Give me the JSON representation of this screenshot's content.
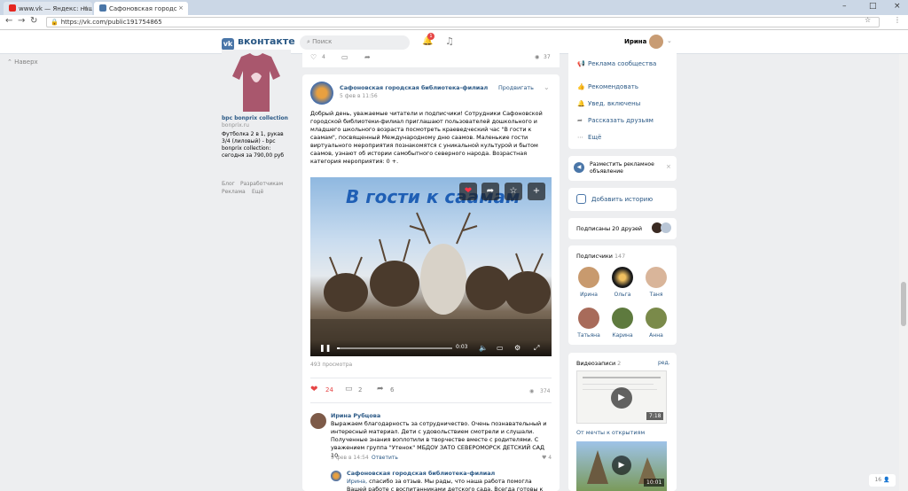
{
  "browser": {
    "tabs": [
      {
        "title": "www.vk — Яндекс: наш"
      },
      {
        "title": "Сафоновская городс"
      }
    ],
    "url": "https://vk.com/public191754865"
  },
  "vk": {
    "logo": "вконтакте",
    "search_placeholder": "Поиск",
    "notif_count": "1",
    "user_name": "Ирина"
  },
  "left": {
    "back": "Наверх",
    "ad": {
      "title": "bpc bonprix collection",
      "domain": "bonprix.ru",
      "desc": "Футболка 2 в 1, рукав 3/4 (лиловый) - bpc bonprix collection: сегодня за 790,00 руб"
    },
    "footer": [
      "Блог",
      "Разработчикам",
      "Реклама",
      "Ещё"
    ]
  },
  "topstrip": {
    "likes": "4",
    "views": "37"
  },
  "post": {
    "author": "Сафоновская городская библиотека-филиал",
    "date": "5 фев в 11:56",
    "action": "Продвигать",
    "text": "Добрый день, уважаемые читатели и подписчики! Сотрудники Сафоновской городской библиотеки-филиал приглашают пользователей дошкольного и младшего школьного возраста посмотреть краеведческий час \"В гости к саамам\", посвященный Международному дню саамов. Маленькие гости виртуального мероприятия познакомятся с уникальной культурой и бытом саамов, узнают об истории самобытного северного народа. Возрастная категория мероприятия: 0 +.",
    "video_title": "В гости к саамам",
    "video_time": "0:03",
    "video_progress": 0.02,
    "views": "493 просмотра",
    "likes": "24",
    "comments": "2",
    "shares": "6",
    "seen": "374"
  },
  "comments": [
    {
      "author": "Ирина Рубцова",
      "text": "Выражаем благодарность за сотрудничество. Очень познавательный и интересный материал. Дети с удовольствием смотрели и слушали. Полученные знания воплотили в творчестве вместе с родителями. С уважением группа \"Утенок\" МБДОУ ЗАТО СЕВЕРОМОРСК ДЕТСКИЙ САД 10",
      "date": "5 фев в 14:54",
      "reply": "Ответить",
      "likes": "4"
    },
    {
      "author": "Сафоновская городская библиотека-филиал",
      "to": "Ирина,",
      "text": "спасибо за отзыв. Мы рады, что наша работа помогла Вашей работе с воспитанниками детского сада. Всегда готовы к сотрудничеству"
    }
  ],
  "right": {
    "menu": [
      "Реклама сообщества",
      "Рекомендовать",
      "Увед. включены",
      "Рассказать друзьям",
      "Ещё"
    ],
    "promo": "Разместить рекламное объявление",
    "story": "Добавить историю",
    "friends_sub": "Подписаны 20 друзей",
    "subs_title": "Подписчики",
    "subs_count": "147",
    "subs": [
      "Ирина",
      "Ольга",
      "Таня",
      "Татьяна",
      "Карина",
      "Анна"
    ],
    "videos_title": "Видеозаписи",
    "videos_count": "2",
    "videos_edit": "ред.",
    "video1_time": "7:18",
    "video1_title": "От мечты к открытиям",
    "video2_time": "10:01"
  },
  "chat_count": "16"
}
